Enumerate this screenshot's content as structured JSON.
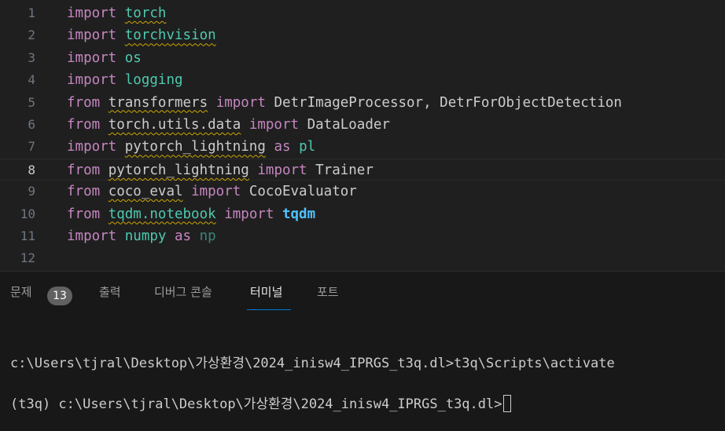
{
  "editor": {
    "lines": [
      {
        "num": "1",
        "t": [
          "import",
          " ",
          "torch"
        ]
      },
      {
        "num": "2",
        "t": [
          "import",
          " ",
          "torchvision"
        ]
      },
      {
        "num": "3",
        "t": [
          "import",
          " ",
          "os"
        ]
      },
      {
        "num": "4",
        "t": [
          "import",
          " ",
          "logging"
        ]
      },
      {
        "num": "5",
        "t": [
          "from",
          " ",
          "transformers",
          " ",
          "import",
          " DetrImageProcessor, DetrForObjectDetection"
        ]
      },
      {
        "num": "6",
        "t": [
          "from",
          " ",
          "torch.utils.data",
          " ",
          "import",
          " DataLoader"
        ]
      },
      {
        "num": "7",
        "t": [
          "import",
          " ",
          "pytorch_lightning",
          " ",
          "as",
          " ",
          "pl"
        ]
      },
      {
        "num": "8",
        "t": [
          "from",
          " ",
          "pytorch_lightning",
          " ",
          "import",
          " Trainer"
        ]
      },
      {
        "num": "9",
        "t": [
          "from",
          " ",
          "coco_eval",
          " ",
          "import",
          " CocoEvaluator"
        ]
      },
      {
        "num": "10",
        "t": [
          "from",
          " ",
          "tqdm.notebook",
          " ",
          "import",
          " ",
          "tqdm"
        ]
      },
      {
        "num": "11",
        "t": [
          "import",
          " ",
          "numpy",
          " ",
          "as",
          " ",
          "np"
        ]
      },
      {
        "num": "12",
        "t": []
      }
    ],
    "current_line": "8"
  },
  "panel": {
    "tabs": {
      "problems": "문제",
      "problems_count": "13",
      "output": "출력",
      "debug_console": "디버그 콘솔",
      "terminal": "터미널",
      "ports": "포트"
    },
    "active_tab": "terminal"
  },
  "terminal": {
    "line1": "c:\\Users\\tjral\\Desktop\\가상환경\\2024_inisw4_IPRGS_t3q.dl>t3q\\Scripts\\activate",
    "line2": "(t3q) c:\\Users\\tjral\\Desktop\\가상환경\\2024_inisw4_IPRGS_t3q.dl>"
  },
  "colors": {
    "keyword": "#c586c0",
    "module": "#4ec9b0",
    "identifier_bold": "#4fc1ff",
    "warning_squiggle": "#cca700",
    "tab_active_underline": "#0078d4"
  }
}
